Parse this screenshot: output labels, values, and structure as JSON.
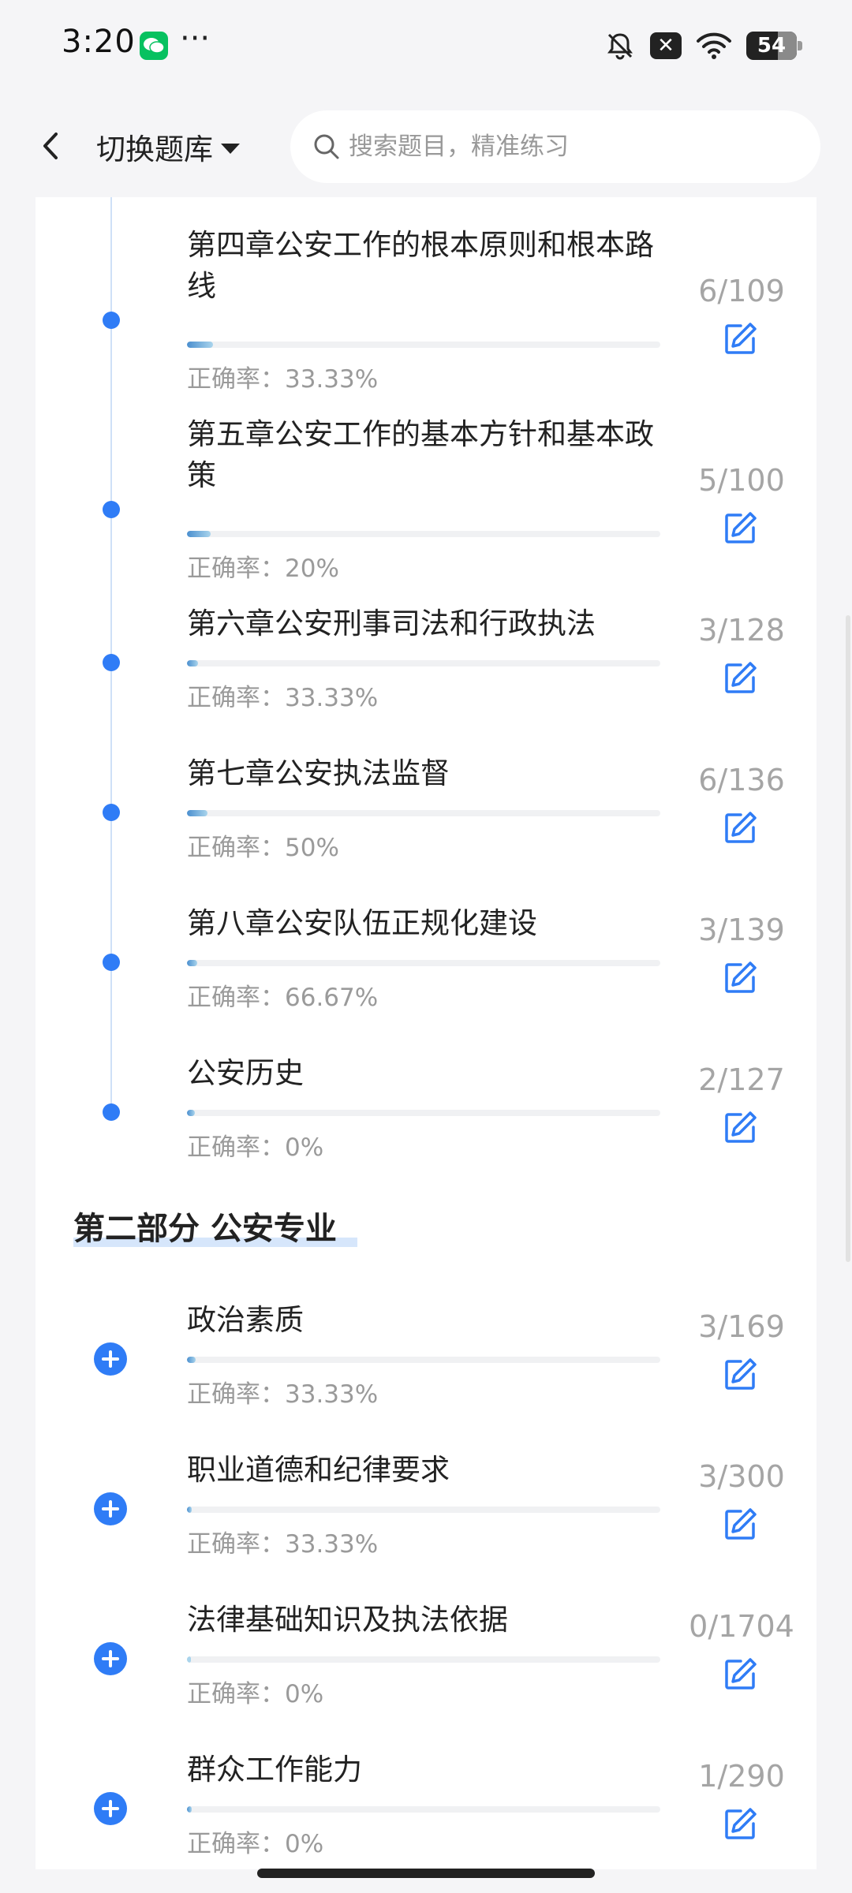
{
  "status": {
    "time": "3:20",
    "more": "···",
    "battery": "54"
  },
  "header": {
    "switch_label": "切换题库",
    "search_placeholder": "搜索题目，精准练习"
  },
  "section2": {
    "title": "第二部分 公安专业"
  },
  "part1_items": [
    {
      "title": "第四章公安工作的根本原则和根本路线",
      "count": "6/109",
      "accuracy": "正确率：33.33%",
      "progress": 0.055
    },
    {
      "title": "第五章公安工作的基本方针和基本政策",
      "count": "5/100",
      "accuracy": "正确率：20%",
      "progress": 0.05
    },
    {
      "title": "第六章公安刑事司法和行政执法",
      "count": "3/128",
      "accuracy": "正确率：33.33%",
      "progress": 0.023
    },
    {
      "title": "第七章公安执法监督",
      "count": "6/136",
      "accuracy": "正确率：50%",
      "progress": 0.044
    },
    {
      "title": "第八章公安队伍正规化建设",
      "count": "3/139",
      "accuracy": "正确率：66.67%",
      "progress": 0.022
    },
    {
      "title": "公安历史",
      "count": "2/127",
      "accuracy": "正确率：0%",
      "progress": 0.016
    }
  ],
  "part2_items": [
    {
      "title": "政治素质",
      "count": "3/169",
      "accuracy": "正确率：33.33%",
      "progress": 0.018
    },
    {
      "title": "职业道德和纪律要求",
      "count": "3/300",
      "accuracy": "正确率：33.33%",
      "progress": 0.01
    },
    {
      "title": "法律基础知识及执法依据",
      "count": "0/1704",
      "accuracy": "正确率：0%",
      "progress": 0
    },
    {
      "title": "群众工作能力",
      "count": "1/290",
      "accuracy": "正确率：0%",
      "progress": 0.003
    }
  ],
  "colors": {
    "accent": "#2f7cf6",
    "muted": "#a5a5a5"
  }
}
